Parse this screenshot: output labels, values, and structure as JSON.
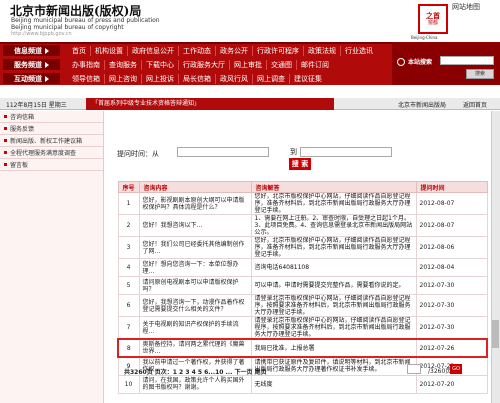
{
  "header": {
    "title": "北京市新闻出版(版权)局",
    "en_title_1": "Beijing municipal bureau of press and publication",
    "en_title_2": "Beijing municipal bureau of copyright",
    "url": "http://www.bjppb.gov.cn",
    "emblem_top": "之首",
    "emblem_bottom": "窗都",
    "emblem_caption": "Beijing-China",
    "sitemap": "网站地图"
  },
  "nav": {
    "rows": [
      {
        "label": "信息频道",
        "items": [
          "首页",
          "机构设置",
          "政府信息公开",
          "工作动态",
          "政务公开",
          "行政许可程序",
          "政策法规",
          "行业选讯"
        ]
      },
      {
        "label": "服务频道",
        "items": [
          "办事指南",
          "查询服务",
          "下载中心",
          "行政服务大厅",
          "网上审批",
          "交通图",
          "邮件订阅"
        ]
      },
      {
        "label": "互动频道",
        "items": [
          "领导信箱",
          "网上咨询",
          "网上投诉",
          "局长信箱",
          "政风行风",
          "网上调查",
          "建议征集"
        ]
      }
    ],
    "search_label": "本站搜索",
    "search_button": "搜索"
  },
  "date": "112年8月15日 星期三",
  "marquee": "「首届系列中级专业技术资格答辩通知」",
  "breadcrumb": [
    "北京市新闻出版局",
    "返回首页"
  ],
  "sidebar": [
    "咨询信箱",
    "服务反馈",
    "新闻出版、新权工作建议箱",
    "全程代理服务满意度调查",
    "留言板"
  ],
  "form": {
    "label": "提问时间：从",
    "to": "到",
    "button": "搜 索"
  },
  "table": {
    "headers": [
      "序号",
      "咨询内容",
      "咨询解答",
      "提问时间"
    ],
    "rows": [
      {
        "n": "1",
        "q": "您好，影视剧剧本原创大纲可以申请版权保护吗？具体流程是什么？",
        "a": "您好，北京市版权保护中心网站，仔细阅读作品自愿登记程序，准备齐材料后，到北京市新闻出版局行政服务大厅办理登记手续。",
        "d": "2012-08-07"
      },
      {
        "n": "2",
        "q": "您好！我想咨询以下...",
        "a": "1、需要在网上注册。2、审查时限，自受理之日起1个月。3、此项目免费。4、查询信息需登录北京市新闻出版局网站公示。",
        "d": "2012-08-07"
      },
      {
        "n": "3",
        "q": "您好！我们公司已经委托其他编制创作了网...",
        "a": "您好，北京市版权保护中心网站，仔细阅读作品自愿登记程序，准备齐材料后，到北京市新闻出版局行政服务大厅办理登记手续。",
        "d": "2012-08-06"
      },
      {
        "n": "4",
        "q": "您好！想向您咨询一下：本单位想办理...",
        "a": "咨询电话64081108",
        "d": "2012-08-04"
      },
      {
        "n": "5",
        "q": "请问原创电视剧本可以申请版权保护吗？",
        "a": "可以申请。申请时需要提交完整作品，需要看你说的定。",
        "d": "2012-07-30"
      },
      {
        "n": "6",
        "q": "您好，我想咨询一下，动漫作品着作权登记需要提交什么相关的文件？",
        "a": "请登录北京市版权保护中心网站，仔细阅读作品自愿登记程序，按照要求准备齐材料后，到北京市新闻出版局行政服务大厅办理登记手续。",
        "d": "2012-07-30"
      },
      {
        "n": "7",
        "q": "关于电视剧的知识产权保护的手续流程...",
        "a": "请登录北京市版权保护中心的网站，仔细阅读作品自愿登记程序，按照要求准备齐材料后，到北京市新闻出版局行政服务大厅办理登记手续。",
        "d": "2012-07-30"
      },
      {
        "n": "8",
        "q": "奥斯备控持，请问两之累代理的《魔兽世界...",
        "a": "我局已批准，上报总署",
        "d": "2012-07-26"
      },
      {
        "n": "9",
        "q": "我以前申请过一个著作权，并获得了著作权...",
        "a": "请携带已获证原件及复印件，填说明等材料，到北京市新闻出版局行政服务大厅办理著作权证书补发手续。",
        "d": "2012-07-23"
      },
      {
        "n": "10",
        "q": "请问，在我国，政策允许个人购买国外的图书版权吗？谢谢。",
        "a": "无线度",
        "d": "2012-07-20"
      }
    ]
  },
  "pagination": {
    "text": "共3260页 页次：1 2 3 4 5 6...10 ... 下一页 尾页",
    "page_value": "",
    "total": "/3260页",
    "go": "GO"
  }
}
